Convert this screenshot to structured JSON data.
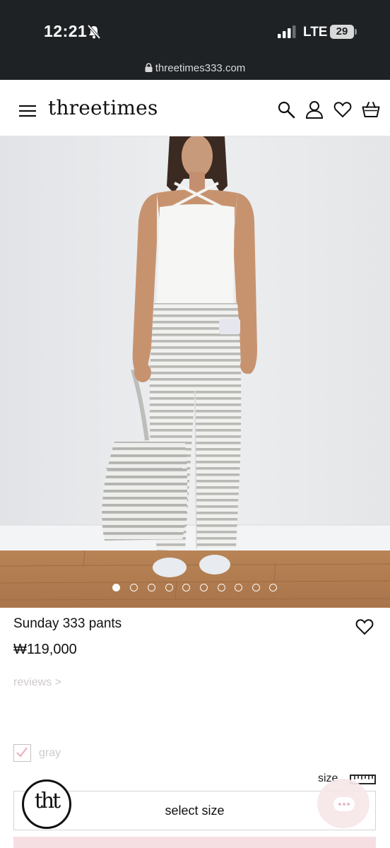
{
  "status_bar": {
    "time": "12:21",
    "network": "LTE",
    "battery": "29",
    "url": "threetimes333.com"
  },
  "header": {
    "logo": "threetimes",
    "icons": [
      "menu-icon",
      "search-icon",
      "account-icon",
      "heart-icon",
      "cart-icon"
    ]
  },
  "gallery": {
    "image_count": 10,
    "active_index": 0
  },
  "product": {
    "name": "Sunday 333 pants",
    "price": "₩119,000",
    "reviews_label": "reviews >",
    "color_label": "gray",
    "size_guide_label": "size",
    "select_size_label": "select size"
  },
  "badge": {
    "text": "tht"
  },
  "colors": {
    "status_bar_bg": "#1e2225",
    "accent_pink": "#f5dfe3",
    "muted_text": "#cfc9ca"
  }
}
